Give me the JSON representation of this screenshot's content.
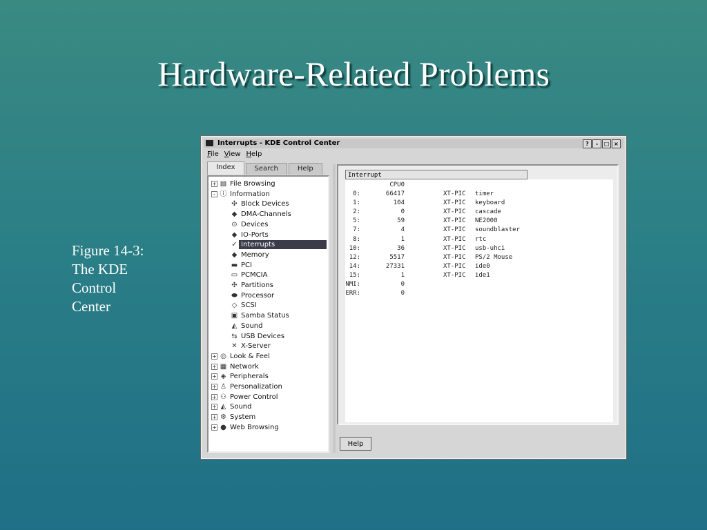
{
  "slide": {
    "title": "Hardware-Related Problems",
    "caption_lines": [
      "Figure 14-3:",
      "The KDE",
      "Control",
      "Center"
    ]
  },
  "window": {
    "title": "Interrupts - KDE Control Center",
    "controls": {
      "help": "?",
      "minimize": "-",
      "maximize": "□",
      "close": "×"
    },
    "menu": [
      "File",
      "View",
      "Help"
    ],
    "tabs": [
      "Index",
      "Search",
      "Help"
    ],
    "active_tab": "Index",
    "tree": [
      {
        "label": "File Browsing",
        "level": 0,
        "expander": "+",
        "icon": "folder-icon"
      },
      {
        "label": "Information",
        "level": 0,
        "expander": "-",
        "icon": "info-icon"
      },
      {
        "label": "Block Devices",
        "level": 1,
        "icon": "block-devices-icon"
      },
      {
        "label": "DMA-Channels",
        "level": 1,
        "icon": "dma-channels-icon"
      },
      {
        "label": "Devices",
        "level": 1,
        "icon": "devices-icon"
      },
      {
        "label": "IO-Ports",
        "level": 1,
        "icon": "io-ports-icon"
      },
      {
        "label": "Interrupts",
        "level": 1,
        "icon": "interrupts-icon",
        "selected": true
      },
      {
        "label": "Memory",
        "level": 1,
        "icon": "memory-icon"
      },
      {
        "label": "PCI",
        "level": 1,
        "icon": "pci-icon"
      },
      {
        "label": "PCMCIA",
        "level": 1,
        "icon": "pcmcia-icon"
      },
      {
        "label": "Partitions",
        "level": 1,
        "icon": "partitions-icon"
      },
      {
        "label": "Processor",
        "level": 1,
        "icon": "processor-icon"
      },
      {
        "label": "SCSI",
        "level": 1,
        "icon": "scsi-icon"
      },
      {
        "label": "Samba Status",
        "level": 1,
        "icon": "samba-status-icon"
      },
      {
        "label": "Sound",
        "level": 1,
        "icon": "sound-icon"
      },
      {
        "label": "USB Devices",
        "level": 1,
        "icon": "usb-devices-icon"
      },
      {
        "label": "X-Server",
        "level": 1,
        "icon": "x-server-icon"
      },
      {
        "label": "Look & Feel",
        "level": 0,
        "expander": "+",
        "icon": "look-feel-icon"
      },
      {
        "label": "Network",
        "level": 0,
        "expander": "+",
        "icon": "network-icon"
      },
      {
        "label": "Peripherals",
        "level": 0,
        "expander": "+",
        "icon": "peripherals-icon"
      },
      {
        "label": "Personalization",
        "level": 0,
        "expander": "+",
        "icon": "personalization-icon"
      },
      {
        "label": "Power Control",
        "level": 0,
        "expander": "+",
        "icon": "power-control-icon"
      },
      {
        "label": "Sound",
        "level": 0,
        "expander": "+",
        "icon": "sound-icon"
      },
      {
        "label": "System",
        "level": 0,
        "expander": "+",
        "icon": "system-icon"
      },
      {
        "label": "Web Browsing",
        "level": 0,
        "expander": "+",
        "icon": "web-browsing-icon"
      }
    ],
    "interrupt_list": {
      "header": "Interrupt",
      "column_header": "CPU0",
      "rows": [
        {
          "irq": "0:",
          "count": "66417",
          "type": "XT-PIC",
          "device": "timer"
        },
        {
          "irq": "1:",
          "count": "104",
          "type": "XT-PIC",
          "device": "keyboard"
        },
        {
          "irq": "2:",
          "count": "0",
          "type": "XT-PIC",
          "device": "cascade"
        },
        {
          "irq": "5:",
          "count": "59",
          "type": "XT-PIC",
          "device": "NE2000"
        },
        {
          "irq": "7:",
          "count": "4",
          "type": "XT-PIC",
          "device": "soundblaster"
        },
        {
          "irq": "8:",
          "count": "1",
          "type": "XT-PIC",
          "device": "rtc"
        },
        {
          "irq": "10:",
          "count": "36",
          "type": "XT-PIC",
          "device": "usb-uhci"
        },
        {
          "irq": "12:",
          "count": "5517",
          "type": "XT-PIC",
          "device": "PS/2 Mouse"
        },
        {
          "irq": "14:",
          "count": "27331",
          "type": "XT-PIC",
          "device": "ide0"
        },
        {
          "irq": "15:",
          "count": "1",
          "type": "XT-PIC",
          "device": "ide1"
        },
        {
          "irq": "NMI:",
          "count": "0",
          "type": "",
          "device": ""
        },
        {
          "irq": "ERR:",
          "count": "0",
          "type": "",
          "device": ""
        }
      ]
    },
    "help_button": "Help"
  }
}
